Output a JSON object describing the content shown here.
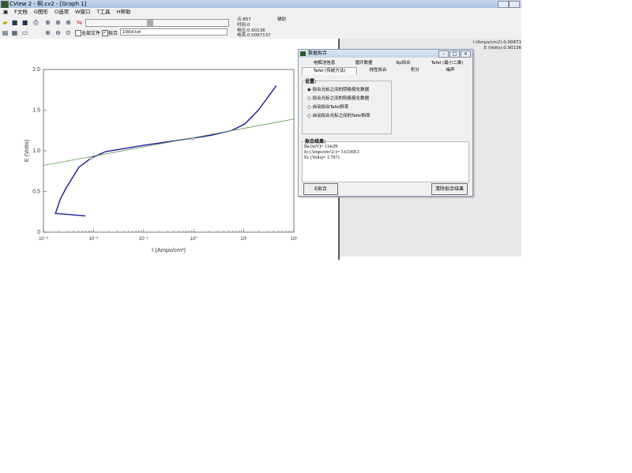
{
  "window": {
    "title": "CView 2 - 啊.cv2 - [Graph 1]"
  },
  "menu": [
    "F文档",
    "G图形",
    "O选项",
    "W窗口",
    "T工具",
    "H帮助"
  ],
  "toolbar": {
    "file_select": "100d.txt",
    "all_files_label": "全部文件",
    "fit_label": "拟合",
    "fit_checked": true,
    "all_files_checked": false
  },
  "status": {
    "point": "点:857",
    "time": "时间:0",
    "potential": "电位:0.90136",
    "current": "电流:0.0087137",
    "aux": "辅助"
  },
  "cursor_readout": {
    "i": "I (Amps/cm2):0.00871",
    "e": "E (Volts):0.90136"
  },
  "dialog": {
    "title": "数据拟合",
    "tabs_row1": [
      "电解池信息",
      "循环数据",
      "Rp拟合",
      "Tafel (最小二乘)"
    ],
    "tabs_row2": [
      "Tafel (传统方法)",
      "线性拟合",
      "积分",
      "噪声"
    ],
    "settings_label": "设置:",
    "options": [
      "拟合光标之间的阴极极化数据",
      "拟合光标之间的阳极极化数据",
      "自动拟合Tafel斜率",
      "自动拟合光标之间的Tafel斜率"
    ],
    "selected_option": 0,
    "results_label": "拟合结果:",
    "results": [
      "Ba (mV)= 114.09",
      "Io (Amps/cm^2-)= 3.6336E3",
      "Ec (Volts)= 1.7971"
    ],
    "fit_button": "E拟合",
    "clear_button": "清除拟合结果"
  },
  "chart_data": {
    "type": "line",
    "xlabel": "I (Amps/cm²)",
    "ylabel": "E (Volts)",
    "xscale": "log",
    "xlim": [
      -3,
      2
    ],
    "ylim": [
      0,
      2
    ],
    "xticks": [
      "10⁻³",
      "10⁻²",
      "10⁻¹",
      "10⁰",
      "10¹",
      "10²"
    ],
    "yticks": [
      "0",
      "0.5",
      "1.0",
      "1.5",
      "2.0"
    ],
    "series": [
      {
        "name": "data",
        "color": "#1a1aa0",
        "log_x": [
          -2.16,
          -2.76,
          -2.66,
          -2.55,
          -2.29,
          -2.05,
          -1.76,
          -0.98,
          -0.19,
          0.34,
          0.76,
          1.02,
          1.29,
          1.65
        ],
        "y": [
          0.2,
          0.23,
          0.41,
          0.54,
          0.8,
          0.91,
          0.99,
          1.07,
          1.14,
          1.19,
          1.25,
          1.33,
          1.5,
          1.8
        ]
      },
      {
        "name": "fit",
        "color": "#5a9a4a",
        "log_x": [
          -3,
          2
        ],
        "y": [
          0.82,
          1.39
        ]
      }
    ],
    "markers": {
      "log_x": [
        -2.05,
        -0.02
      ],
      "y": [
        0.91,
        1.15
      ]
    }
  }
}
